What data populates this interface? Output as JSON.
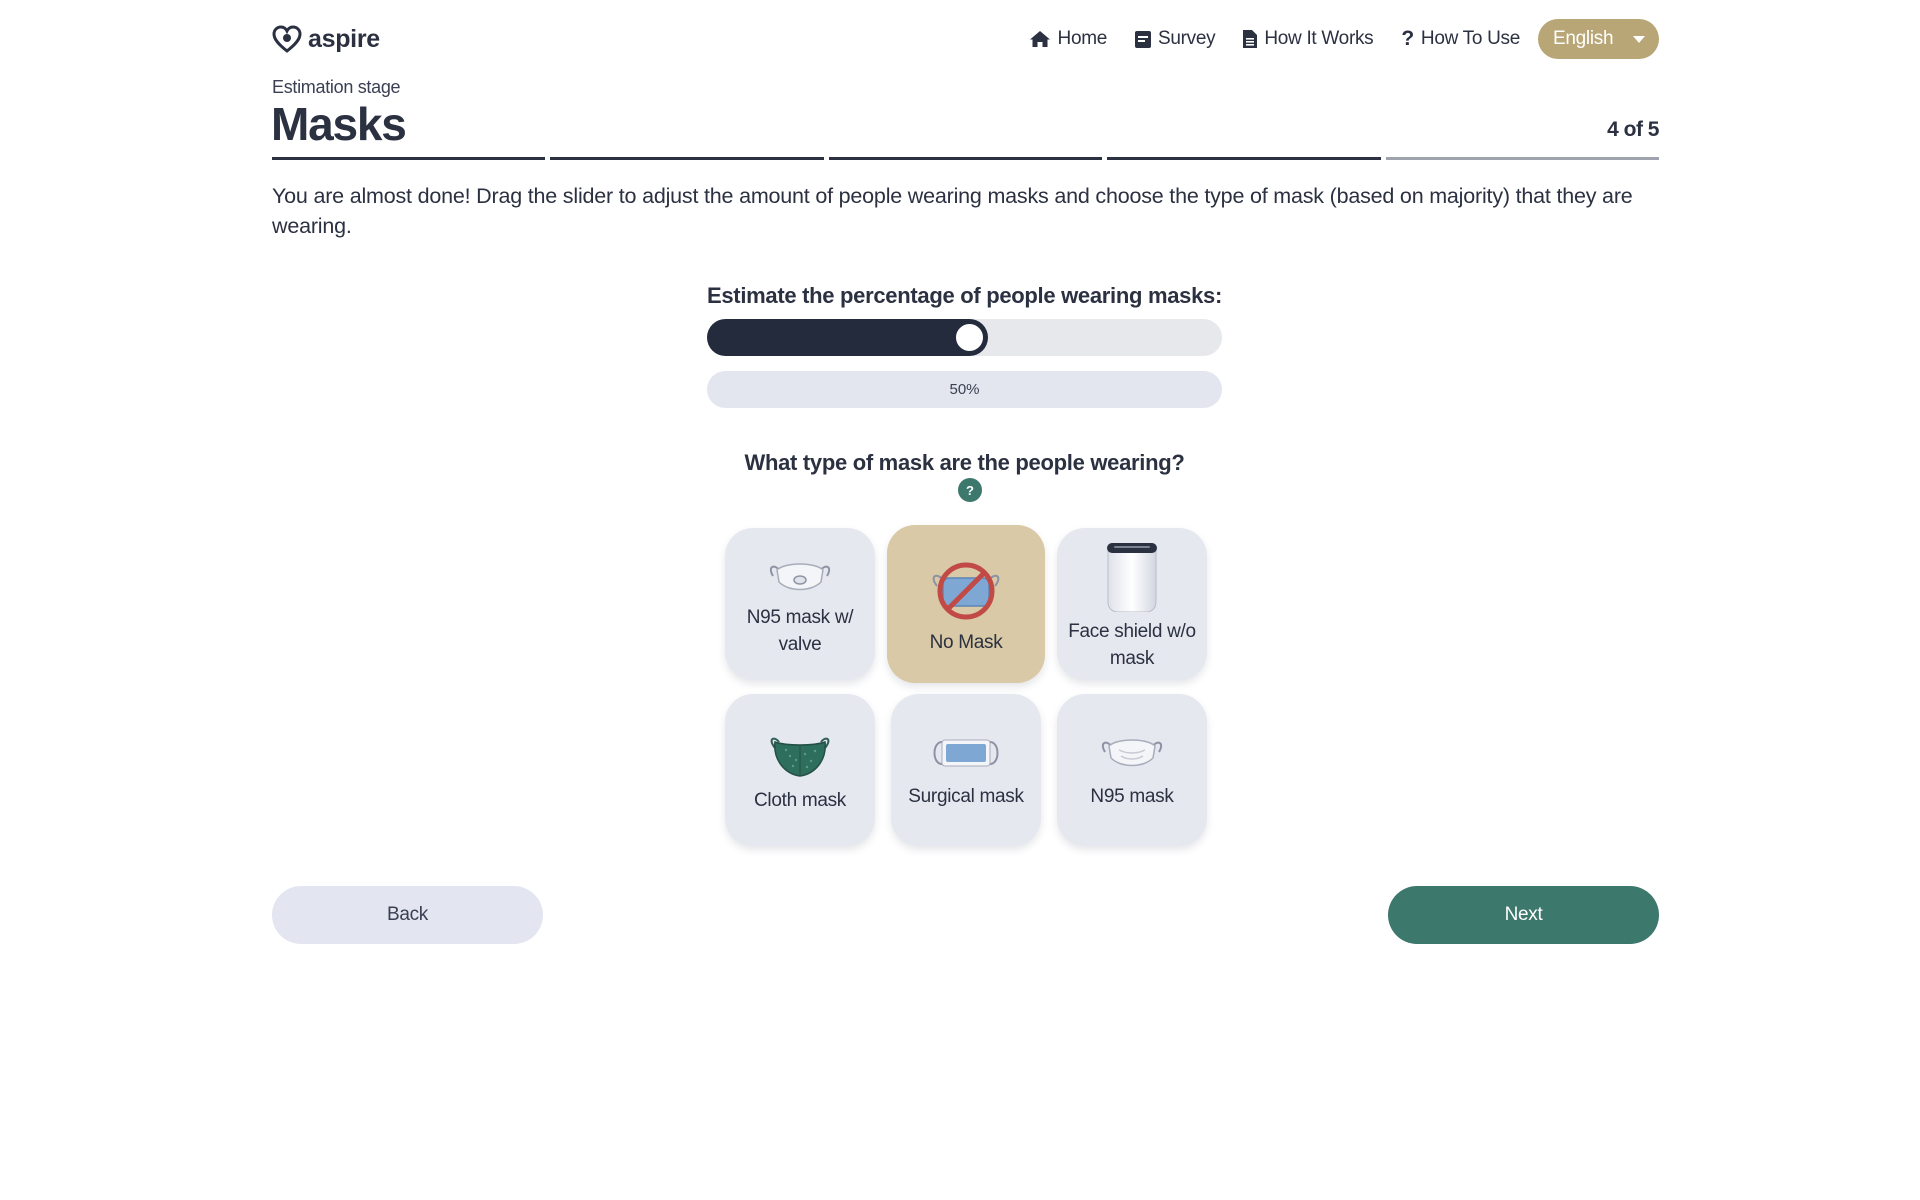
{
  "header": {
    "logo_text": "aspire",
    "nav": [
      {
        "label": "Home",
        "icon": "home-icon"
      },
      {
        "label": "Survey",
        "icon": "survey-icon"
      },
      {
        "label": "How It Works",
        "icon": "document-icon"
      },
      {
        "label": "How To Use",
        "icon": "question-icon"
      }
    ],
    "language": "English"
  },
  "stage": {
    "subtitle": "Estimation stage",
    "title": "Masks",
    "step_text": "4 of 5",
    "current_step": 4,
    "total_steps": 5
  },
  "intro": "You are almost done! Drag the slider to adjust the amount of people wearing masks and choose the type of mask (based on majority) that they are wearing.",
  "slider": {
    "label": "Estimate the percentage of people wearing masks:",
    "value": 50,
    "value_text": "50%"
  },
  "mask_question": {
    "label": "What type of mask are the people wearing?",
    "help": "?"
  },
  "mask_options": [
    {
      "label": "N95 mask w/ valve",
      "icon": "n95-valve-mask-icon",
      "selected": false
    },
    {
      "label": "No Mask",
      "icon": "no-mask-icon",
      "selected": true
    },
    {
      "label": "Face shield w/o mask",
      "icon": "face-shield-icon",
      "selected": false
    },
    {
      "label": "Cloth mask",
      "icon": "cloth-mask-icon",
      "selected": false
    },
    {
      "label": "Surgical mask",
      "icon": "surgical-mask-icon",
      "selected": false
    },
    {
      "label": "N95 mask",
      "icon": "n95-mask-icon",
      "selected": false
    }
  ],
  "buttons": {
    "back": "Back",
    "next": "Next"
  },
  "colors": {
    "primary_dark": "#232b3c",
    "accent_green": "#3d786c",
    "accent_gold": "#b8a676",
    "selected_card": "#d9c9a6",
    "card_bg": "#e6e8f0"
  }
}
